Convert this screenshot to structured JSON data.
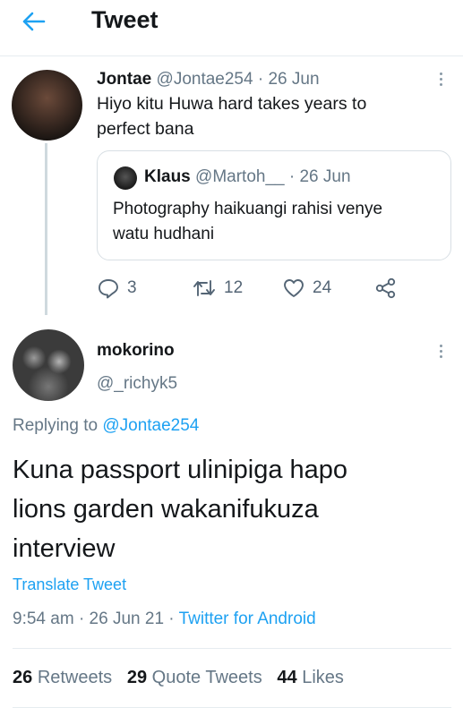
{
  "header": {
    "title": "Tweet"
  },
  "parent_tweet": {
    "name": "Jontae",
    "handle": "@Jontae254",
    "separator": "·",
    "date": "26 Jun",
    "text_line1": "Hiyo kitu Huwa hard takes years to",
    "text_line2": "perfect bana",
    "quote": {
      "name": "Klaus",
      "handle": "@Martoh__",
      "separator": "·",
      "date": "26 Jun",
      "text_line1": "Photography haikuangi rahisi venye",
      "text_line2": "watu hudhani"
    },
    "actions": {
      "replies": "3",
      "retweets": "12",
      "likes": "24"
    }
  },
  "main_tweet": {
    "name": "mokorino",
    "handle": "@_richyk5",
    "replying_prefix": "Replying to",
    "replying_handle": "@Jontae254",
    "text_line1": "Kuna passport ulinipiga hapo",
    "text_line2": "lions garden wakanifukuza",
    "text_line3": "interview",
    "translate": "Translate Tweet",
    "time": "9:54 am",
    "date": "26 Jun 21",
    "separator": "·",
    "source": "Twitter for Android",
    "stats": {
      "retweets_count": "26",
      "retweets_label": "Retweets",
      "quotes_count": "29",
      "quotes_label": "Quote Tweets",
      "likes_count": "44",
      "likes_label": "Likes"
    }
  },
  "colors": {
    "accent": "#1da1f2",
    "muted": "#657786",
    "text": "#14171a"
  }
}
